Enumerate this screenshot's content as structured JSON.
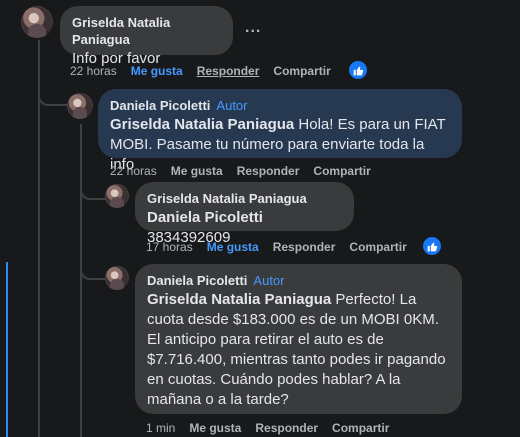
{
  "comment1": {
    "author": "Griselda Natalia Paniagua",
    "text": "Info por favor",
    "more": "...",
    "time": "22 horas",
    "like": "Me gusta",
    "reply": "Responder",
    "share": "Compartir"
  },
  "reply1": {
    "author": "Daniela Picoletti",
    "badge": "Autor",
    "mention": "Griselda Natalia Paniagua",
    "text": " Hola! Es para un FIAT MOBI. Pasame tu número para enviarte toda la info",
    "time": "22 horas",
    "like": "Me gusta",
    "reply": "Responder",
    "share": "Compartir"
  },
  "reply2": {
    "author": "Griselda Natalia Paniagua",
    "mention": "Daniela Picoletti",
    "text": " 3834392609",
    "time": "17 horas",
    "like": "Me gusta",
    "reply": "Responder",
    "share": "Compartir"
  },
  "reply3": {
    "author": "Daniela Picoletti",
    "badge": "Autor",
    "mention": "Griselda Natalia Paniagua",
    "text": " Perfecto! La cuota desde $183.000 es de un MOBI 0KM. El anticipo para retirar el auto es de $7.716.400, mientras tanto podes ir pagando en cuotas. Cuándo podes hablar? A la mañana o a la tarde?",
    "time": "1 min",
    "like": "Me gusta",
    "reply": "Responder",
    "share": "Compartir"
  },
  "icons": {
    "like_reaction": "thumbs-up-icon",
    "more": "more-options-icon"
  },
  "colors": {
    "background": "#18191a",
    "bubble": "#3a3b3c",
    "highlight_bubble": "#263951",
    "link_blue": "#4599ff",
    "reaction_blue": "#1877f2"
  }
}
